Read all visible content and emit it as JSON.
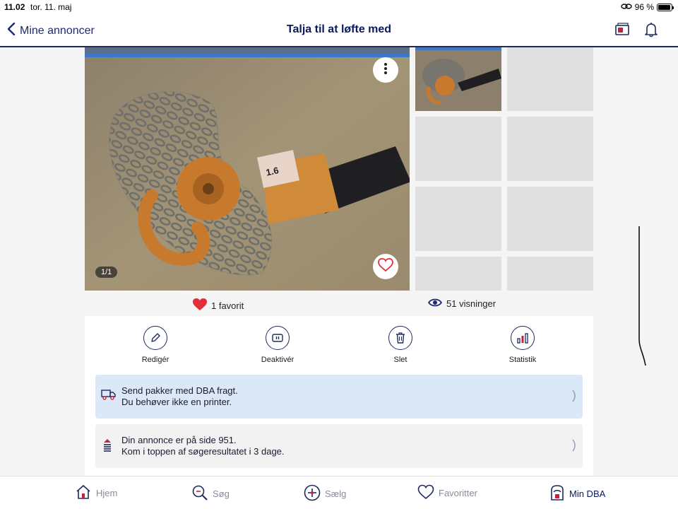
{
  "status_bar": {
    "time": "11.02",
    "date": "tor. 11. maj",
    "battery": "96 %"
  },
  "nav": {
    "back_label": "Mine annoncer",
    "title": "Talja til at løfte med"
  },
  "photo": {
    "counter": "1/1"
  },
  "stats": {
    "favorites": "1 favorit",
    "views": "51 visninger"
  },
  "actions": [
    {
      "label": "Redigér",
      "icon": "pencil-icon"
    },
    {
      "label": "Deaktivér",
      "icon": "pause-icon"
    },
    {
      "label": "Slet",
      "icon": "trash-icon"
    },
    {
      "label": "Statistik",
      "icon": "bar-chart-icon"
    }
  ],
  "banners": [
    {
      "line1": "Send pakker med DBA fragt.",
      "line2": "Du behøver ikke en printer.",
      "icon": "delivery-truck-icon"
    },
    {
      "line1": "Din annonce er på side 951.",
      "line2": "Kom i toppen af søgeresultatet i 3 dage.",
      "icon": "boost-icon"
    }
  ],
  "tabs": [
    {
      "label": "Hjem",
      "icon": "home-icon"
    },
    {
      "label": "Søg",
      "icon": "search-icon"
    },
    {
      "label": "Sælg",
      "icon": "plus-circle-icon"
    },
    {
      "label": "Favoritter",
      "icon": "heart-icon"
    },
    {
      "label": "Min DBA",
      "icon": "profile-icon"
    }
  ],
  "colors": {
    "navy": "#0b1a5e",
    "heart_red": "#e0303a",
    "banner_blue": "#dbe8f8",
    "inactive_tab": "#8a8a9a"
  }
}
